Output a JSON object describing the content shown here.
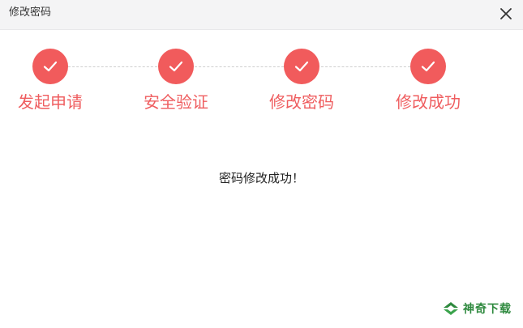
{
  "dialog": {
    "title": "修改密码"
  },
  "steps": [
    {
      "label": "发起申请",
      "status": "completed"
    },
    {
      "label": "安全验证",
      "status": "completed"
    },
    {
      "label": "修改密码",
      "status": "completed"
    },
    {
      "label": "修改成功",
      "status": "completed"
    }
  ],
  "message": "密码修改成功！",
  "watermark": {
    "text": "神奇下载"
  },
  "colors": {
    "accent": "#f15b5c",
    "step_label": "#ef5d5f",
    "titlebar_bg": "#f4f4f5",
    "watermark": "#2f8a3f"
  },
  "icons": {
    "close": "close-icon",
    "step": "checkmark-icon",
    "watermark": "logo-icon"
  }
}
